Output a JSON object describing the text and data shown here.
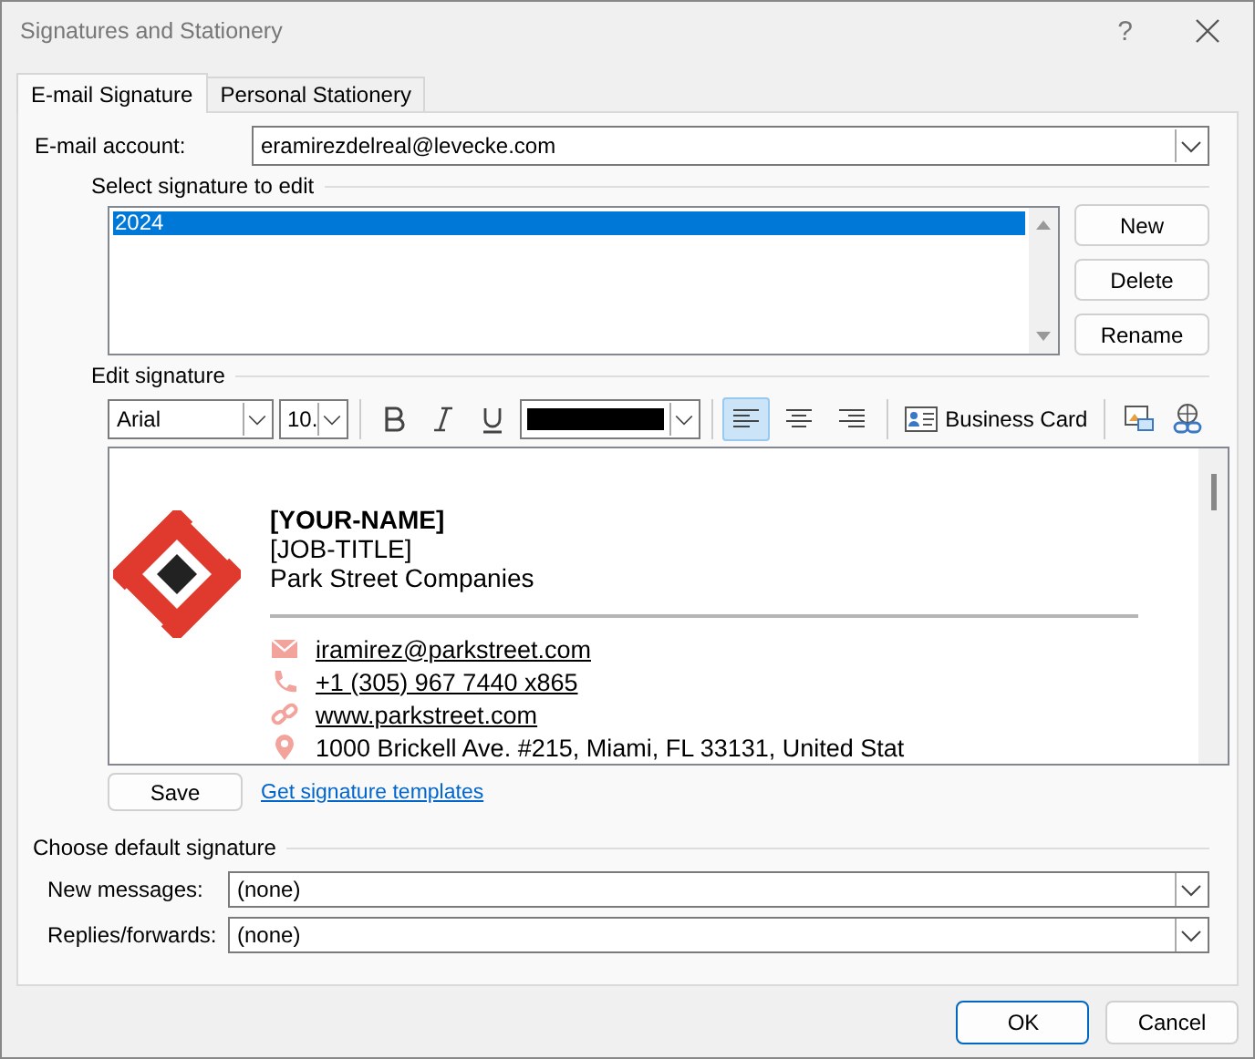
{
  "window": {
    "title": "Signatures and Stationery",
    "help": "?"
  },
  "tabs": [
    {
      "label": "E-mail Signature",
      "selected": true
    },
    {
      "label": "Personal Stationery",
      "selected": false
    }
  ],
  "account": {
    "label": "E-mail account:",
    "value": "eramirezdelreal@levecke.com"
  },
  "select": {
    "heading": "Select signature to edit",
    "signatures": [
      {
        "name": "2024",
        "selected": true
      }
    ],
    "buttons": [
      "New",
      "Delete",
      "Rename"
    ]
  },
  "edit": {
    "heading": "Edit signature",
    "font": "Arial",
    "size": "10.",
    "align": [
      {
        "kind": "left",
        "selected": true
      },
      {
        "kind": "center",
        "selected": false
      },
      {
        "kind": "right",
        "selected": false
      }
    ],
    "business_card": "Business Card"
  },
  "signature": {
    "name": "[YOUR-NAME]",
    "job_title": "[JOB-TITLE]",
    "company": "Park Street Companies",
    "contacts": [
      {
        "kind": "email",
        "text": "iramirez@parkstreet.com"
      },
      {
        "kind": "phone",
        "text": "+1 (305) 967 7440 x865"
      },
      {
        "kind": "web",
        "text": "www.parkstreet.com"
      },
      {
        "kind": "address",
        "text": "1000 Brickell Ave. #215, Miami, FL 33131, United Stat"
      }
    ]
  },
  "save": "Save",
  "templates_link": "Get signature templates",
  "defaults": {
    "heading": "Choose default signature",
    "fields": [
      {
        "label": "New messages:",
        "value": "(none)"
      },
      {
        "label": "Replies/forwards:",
        "value": "(none)"
      }
    ]
  },
  "buttons": [
    {
      "label": "OK",
      "default": true
    },
    {
      "label": "Cancel",
      "default": false
    }
  ]
}
